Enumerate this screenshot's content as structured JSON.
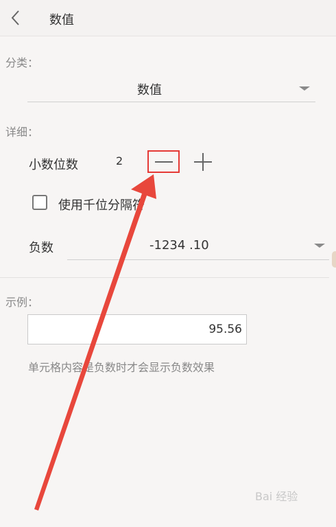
{
  "header": {
    "title": "数值"
  },
  "category": {
    "label": "分类：",
    "value": "数值"
  },
  "details": {
    "label": "详细：",
    "decimal_places_label": "小数位数",
    "decimal_places_value": "2",
    "thousands_separator_label": "使用千位分隔符",
    "thousands_separator_checked": false,
    "negative_label": "负数",
    "negative_value": "-1234 .10"
  },
  "example": {
    "label": "示例：",
    "value": "95.56",
    "hint": "单元格内容是负数时才会显示负数效果"
  },
  "annotation": {
    "highlight_color": "#e53935",
    "arrow_color": "#e8473c"
  },
  "watermark": {
    "text": "Bai 经验"
  },
  "icons": {
    "back": "chevron-left-icon",
    "dropdown": "triangle-down-icon",
    "minus": "minus-icon",
    "plus": "plus-icon"
  }
}
